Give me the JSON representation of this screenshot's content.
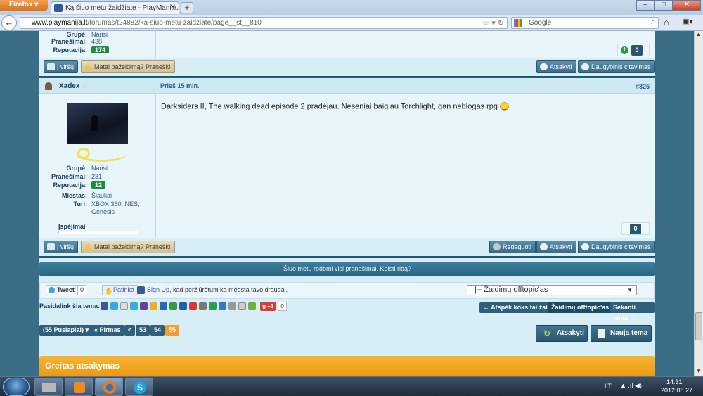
{
  "browser": {
    "app_button": "Firefox",
    "tab_title": "Ką šiuo metu žaidžiate - PlayManija.lt - P...",
    "new_tab": "+",
    "url_domain": "www.playmanija.lt",
    "url_path": "/forumas/t24882/ka-siuo-metu-zaidziate/page__st__810",
    "search_placeholder": "Google"
  },
  "prev_post": {
    "group_label": "Grupė:",
    "group_value": "Narisi",
    "posts_label": "Pranešimai:",
    "posts_value": "438",
    "rep_label": "Reputacija:",
    "rep_value": "174",
    "plus_count": "0",
    "btn_top": "Į viršų",
    "btn_report": "Matai pažeidimą? Pranešk!",
    "btn_reply": "Atsakyti",
    "btn_multiquote": "Daugybinis citavimas"
  },
  "post": {
    "author": "Xadex",
    "time": "Prieš 15 min.",
    "number": "#825",
    "text": "Darksiders II, The walking dead episode 2 pradėjau. Neseniai baigiau Torchlight, gan neblogas rpg",
    "group_label": "Grupė:",
    "group_value": "Narisi",
    "posts_label": "Pranešimai:",
    "posts_value": "231",
    "rep_label": "Reputacija:",
    "rep_value": "12",
    "city_label": "Miestas:",
    "city_value": "Šiauliai",
    "owns_label": "Turi:",
    "owns_value_1": "XBOX 360, NES,",
    "owns_value_2": "Genesis",
    "warnings_label": "Įspėjimai",
    "rep_count": "0",
    "btn_top": "Į viršų",
    "btn_report": "Matai pažeidimą? Pranešk!",
    "btn_edit": "Redaguoti",
    "btn_reply": "Atsakyti",
    "btn_multiquote": "Daugybinis citavimas"
  },
  "notice": "Šiuo metu rodomi visi pranešimai. Keisti ribą?",
  "social": {
    "tweet": "Tweet",
    "tweet_count": "0",
    "like": "Patinka",
    "fb_signup": "Sign Up",
    "fb_text": ", kad peržiūrėtum ką mėgsta tavo draugai.",
    "forum_select": "|-- Žaidimų offtopic'as",
    "share_label": "Pasidalink šia tema:",
    "gplus": "+1",
    "gplus_count": "0"
  },
  "topic_nav": {
    "prev": "← Atspėk koks tai žaidimas",
    "current": "Žaidimų offtopic'as",
    "next": "Sekanti tema →"
  },
  "pagination": {
    "pages_btn": "(55 Puslapiai)",
    "first": "« Pirmas",
    "prev": "<",
    "pages": [
      "53",
      "54",
      "55"
    ],
    "current": "55"
  },
  "actions": {
    "reply": "Atsakyti",
    "new_topic": "Nauja tema"
  },
  "quick_reply": {
    "title": "Greitas atsakymas"
  },
  "taskbar": {
    "lang": "LT",
    "time": "14:31",
    "date": "2012.08.27"
  },
  "colors": {
    "accent": "#2c5670",
    "reputation": "#1f8a3b",
    "quick_reply": "#f5a623",
    "page_current": "#f0a030"
  }
}
